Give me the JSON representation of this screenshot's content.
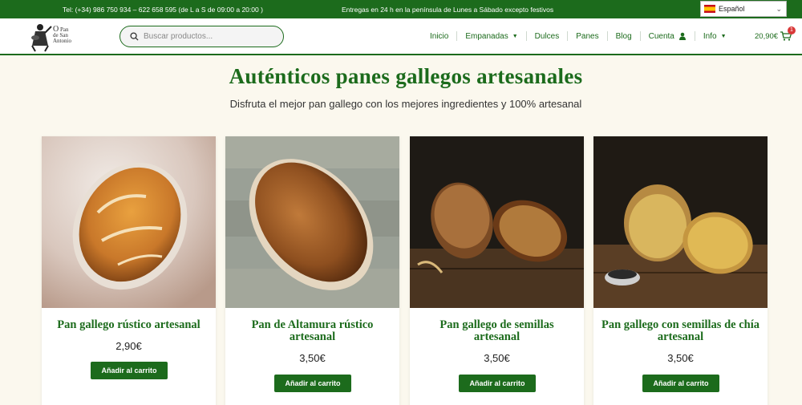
{
  "topbar": {
    "phone": "Tel: (+34) 986 750 934 – 622 658 595 (de L a S de 09:00 a 20:00 )",
    "delivery": "Entregas en 24 h en la península de Lunes a Sábado excepto festivos",
    "language": "Español"
  },
  "logo": {
    "line1": "O",
    "line2": "Pan",
    "line3": "de San",
    "line4": "Antonio"
  },
  "search": {
    "placeholder": "Buscar productos..."
  },
  "nav": {
    "items": [
      {
        "label": "Inicio"
      },
      {
        "label": "Empanadas"
      },
      {
        "label": "Dulces"
      },
      {
        "label": "Panes"
      },
      {
        "label": "Blog"
      },
      {
        "label": "Cuenta"
      },
      {
        "label": "Info"
      }
    ]
  },
  "cart": {
    "total": "20,90€",
    "count": "1"
  },
  "hero": {
    "title": "Auténticos panes gallegos artesanales",
    "subtitle": "Disfruta el mejor pan gallego con los mejores ingredientes y 100% artesanal"
  },
  "products": [
    {
      "name": "Pan gallego rústico artesanal",
      "price": "2,90€",
      "button": "Añadir al carrito"
    },
    {
      "name": "Pan de Altamura rústico artesanal",
      "price": "3,50€",
      "button": "Añadir al carrito"
    },
    {
      "name": "Pan gallego de semillas artesanal",
      "price": "3,50€",
      "button": "Añadir al carrito"
    },
    {
      "name": "Pan gallego con semillas de chía artesanal",
      "price": "3,50€",
      "button": "Añadir al carrito"
    }
  ],
  "colors": {
    "brand_green": "#1c6b1c",
    "background": "#fbf8ee",
    "badge_red": "#d93838"
  }
}
